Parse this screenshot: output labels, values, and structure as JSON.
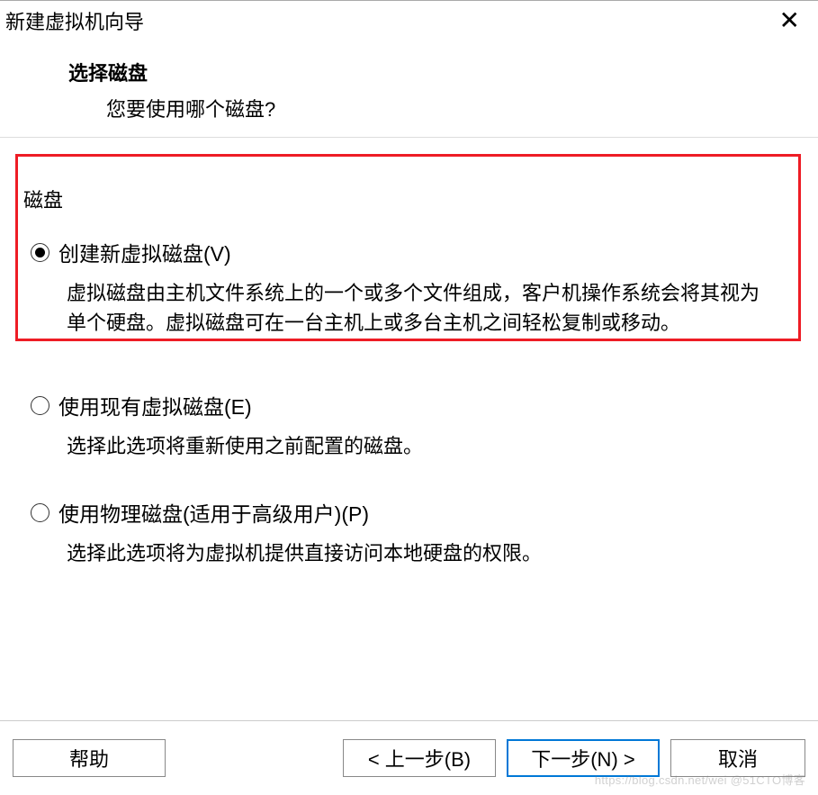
{
  "window": {
    "title": "新建虚拟机向导"
  },
  "header": {
    "title": "选择磁盘",
    "subtitle": "您要使用哪个磁盘?"
  },
  "group_label": "磁盘",
  "options": [
    {
      "label": "创建新虚拟磁盘(V)",
      "description": "虚拟磁盘由主机文件系统上的一个或多个文件组成，客户机操作系统会将其视为单个硬盘。虚拟磁盘可在一台主机上或多台主机之间轻松复制或移动。",
      "checked": true
    },
    {
      "label": "使用现有虚拟磁盘(E)",
      "description": "选择此选项将重新使用之前配置的磁盘。",
      "checked": false
    },
    {
      "label": "使用物理磁盘(适用于高级用户)(P)",
      "description": "选择此选项将为虚拟机提供直接访问本地硬盘的权限。",
      "checked": false
    }
  ],
  "buttons": {
    "help": "帮助",
    "back": "< 上一步(B)",
    "next": "下一步(N) >",
    "cancel": "取消"
  },
  "watermark": "https://blog.csdn.net/wei @51CTO博客"
}
